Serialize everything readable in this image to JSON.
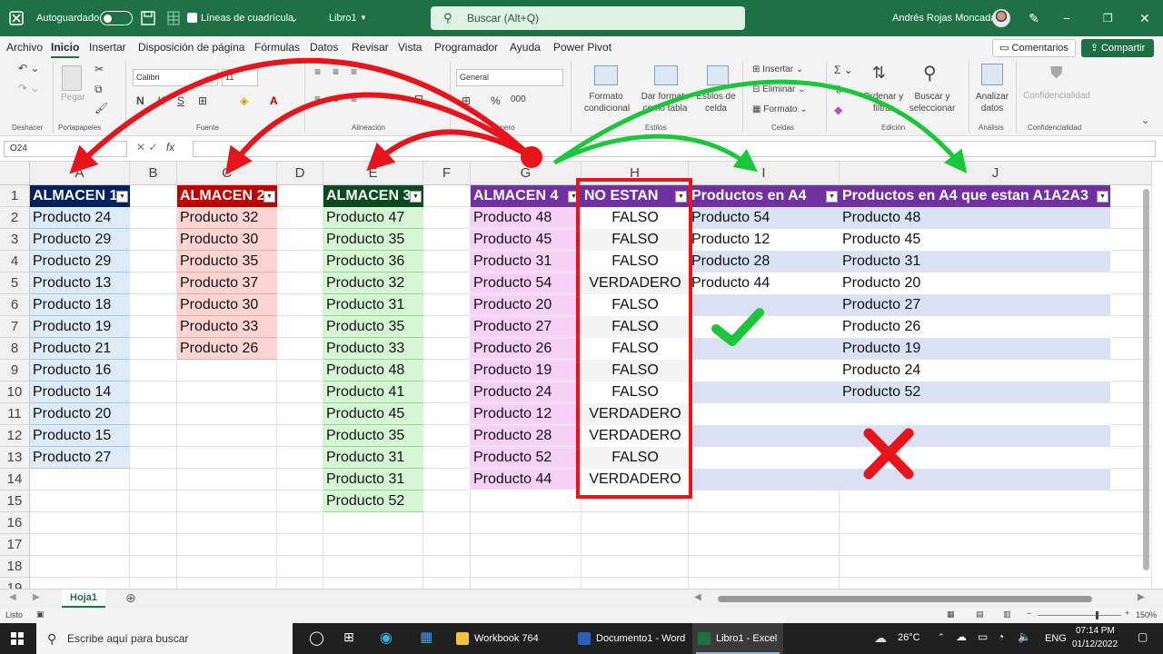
{
  "titlebar": {
    "autosave_label": "Autoguardado",
    "gridlines_label": "Líneas de cuadrícula",
    "file_name": "Libro1",
    "search_placeholder": "Buscar (Alt+Q)",
    "user_name": "Andrés Rojas Moncada"
  },
  "menu": {
    "items": [
      "Archivo",
      "Inicio",
      "Insertar",
      "Disposición de página",
      "Fórmulas",
      "Datos",
      "Revisar",
      "Vista",
      "Programador",
      "Ayuda",
      "Power Pivot"
    ],
    "active": "Inicio",
    "comments_label": "Comentarios",
    "share_label": "Compartir"
  },
  "ribbon": {
    "undo_group": "Deshacer",
    "paste_label": "Pegar",
    "clipboard_group": "Portapapeles",
    "font_name": "Calibri",
    "font_size": "11",
    "font_group": "Fuente",
    "align_group": "Alineación",
    "number_format": "General",
    "number_group": "Número",
    "cond_format_label": "Formato condicional",
    "table_format_label": "Dar formato como tabla",
    "cell_styles_label": "Estilos de celda",
    "styles_group": "Estilos",
    "insert_label": "Insertar",
    "delete_label": "Eliminar",
    "format_label": "Formato",
    "cells_group": "Celdas",
    "sort_filter_label": "Ordenar y filtrar",
    "find_select_label": "Buscar y seleccionar",
    "editing_group": "Edición",
    "analyze_label": "Analizar datos",
    "analysis_group": "Análisis",
    "confidentiality_label": "Confidencialidad",
    "confidentiality_group": "Confidencialidad"
  },
  "formula_bar": {
    "name_box": "O24",
    "fx_label": "fx",
    "formula": ""
  },
  "columns": [
    "A",
    "B",
    "C",
    "D",
    "E",
    "F",
    "G",
    "H",
    "I",
    "J"
  ],
  "rows": [
    "1",
    "2",
    "3",
    "4",
    "5",
    "6",
    "7",
    "8",
    "9",
    "10",
    "11",
    "12",
    "13",
    "14",
    "15",
    "16",
    "17",
    "18",
    "19"
  ],
  "tables": {
    "almacen1": {
      "header": "ALMACEN 1",
      "values": [
        "Producto 24",
        "Producto 29",
        "Producto 29",
        "Producto 13",
        "Producto 18",
        "Producto 19",
        "Producto 21",
        "Producto 16",
        "Producto 14",
        "Producto 20",
        "Producto 15",
        "Producto 27"
      ]
    },
    "almacen2": {
      "header": "ALMACEN 2",
      "values": [
        "Producto 32",
        "Producto 30",
        "Producto 35",
        "Producto 37",
        "Producto 30",
        "Producto 33",
        "Producto 26"
      ]
    },
    "almacen3": {
      "header": "ALMACEN 3",
      "values": [
        "Producto 47",
        "Producto 35",
        "Producto 36",
        "Producto 32",
        "Producto 31",
        "Producto 35",
        "Producto 33",
        "Producto 48",
        "Producto 41",
        "Producto 45",
        "Producto 35",
        "Producto 31",
        "Producto 31",
        "Producto 52"
      ]
    },
    "almacen4": {
      "header": "ALMACEN 4",
      "values": [
        "Producto 48",
        "Producto 45",
        "Producto 31",
        "Producto 54",
        "Producto 20",
        "Producto 27",
        "Producto 26",
        "Producto 19",
        "Producto 24",
        "Producto 12",
        "Producto 28",
        "Producto 52",
        "Producto 44"
      ]
    },
    "no_estan": {
      "header": "NO ESTAN",
      "values": [
        "FALSO",
        "FALSO",
        "FALSO",
        "VERDADERO",
        "FALSO",
        "FALSO",
        "FALSO",
        "FALSO",
        "FALSO",
        "VERDADERO",
        "VERDADERO",
        "FALSO",
        "VERDADERO"
      ]
    },
    "productos_a4": {
      "header": "Productos en A4",
      "values": [
        "Producto 54",
        "Producto 12",
        "Producto 28",
        "Producto 44"
      ]
    },
    "productos_a4_a1a2a3": {
      "header": "Productos en A4 que estan A1A2A3",
      "values": [
        "Producto 48",
        "Producto 45",
        "Producto 31",
        "Producto 20",
        "Producto 27",
        "Producto 26",
        "Producto 19",
        "Producto 24",
        "Producto 52"
      ]
    }
  },
  "colors": {
    "excel_green": "#1e7145",
    "almacen1_header": "#002060",
    "almacen1_fill": "#ddebf7",
    "almacen2_header": "#c00000",
    "almacen2_fill": "#fcd5d3",
    "almacen3_header": "#0b4a1e",
    "almacen3_fill": "#d5f5d5",
    "almacen4_header": "#7030a0",
    "almacen4_fill": "#f7d0f7",
    "band_fill": "#d9e1f2",
    "annotation_red": "#e8141c",
    "annotation_green": "#1cc63a"
  },
  "sheet_tabs": [
    "Hoja1"
  ],
  "status": {
    "ready": "Listo",
    "zoom": "150%"
  },
  "taskbar": {
    "search_placeholder": "Escribe aquí para buscar",
    "apps": [
      "Workbook 764",
      "Documento1 - Word",
      "Libro1 - Excel"
    ],
    "weather": "26°C",
    "language": "ENG",
    "time": "07:14 PM",
    "date": "01/12/2022"
  }
}
